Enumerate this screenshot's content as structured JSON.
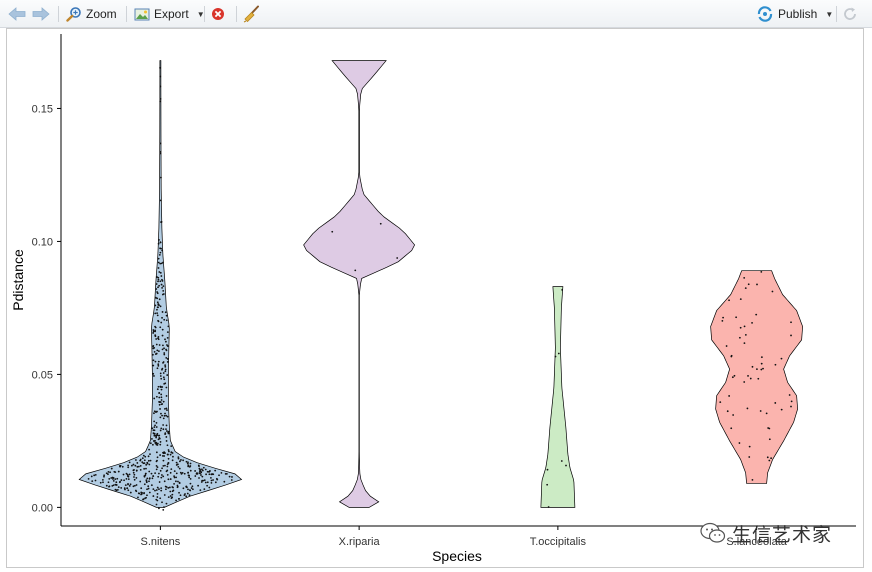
{
  "toolbar": {
    "zoom_label": "Zoom",
    "export_label": "Export",
    "publish_label": "Publish"
  },
  "chart_data": {
    "type": "violin",
    "xlabel": "Species",
    "ylabel": "Pdistance",
    "categories": [
      "S.nitens",
      "X.riparia",
      "T.occipitalis",
      "S.lanceolata"
    ],
    "ylim": [
      -0.007,
      0.178
    ],
    "yticks": [
      0.0,
      0.05,
      0.1,
      0.15
    ],
    "ytick_labels": [
      "0.00",
      "0.05",
      "0.10",
      "0.15"
    ],
    "grid": false,
    "legend": "none",
    "series": [
      {
        "fill": "#b3cde3",
        "points_n": 600,
        "profile": [
          [
            0.0,
            4
          ],
          [
            0.004,
            28
          ],
          [
            0.008,
            62
          ],
          [
            0.011,
            85
          ],
          [
            0.013,
            72
          ],
          [
            0.016,
            42
          ],
          [
            0.02,
            16
          ],
          [
            0.025,
            10
          ],
          [
            0.03,
            9
          ],
          [
            0.04,
            8
          ],
          [
            0.05,
            8
          ],
          [
            0.06,
            8.5
          ],
          [
            0.068,
            9
          ],
          [
            0.075,
            6
          ],
          [
            0.085,
            4.5
          ],
          [
            0.095,
            2.5
          ],
          [
            0.105,
            1.5
          ],
          [
            0.12,
            0.8
          ],
          [
            0.14,
            0.6
          ],
          [
            0.16,
            0.5
          ],
          [
            0.168,
            0.5
          ]
        ]
      },
      {
        "fill": "#decbe4",
        "points_n": 4,
        "profile": [
          [
            0.0,
            10
          ],
          [
            0.002,
            20
          ],
          [
            0.005,
            8
          ],
          [
            0.01,
            2
          ],
          [
            0.013,
            0.6
          ],
          [
            0.02,
            0.2
          ],
          [
            0.08,
            0.2
          ],
          [
            0.086,
            2
          ],
          [
            0.092,
            38
          ],
          [
            0.098,
            57
          ],
          [
            0.104,
            44
          ],
          [
            0.11,
            22
          ],
          [
            0.118,
            4
          ],
          [
            0.125,
            0.3
          ],
          [
            0.15,
            0.3
          ],
          [
            0.157,
            2
          ],
          [
            0.163,
            16
          ],
          [
            0.168,
            27
          ]
        ]
      },
      {
        "fill": "#ccebc5",
        "points_n": 8,
        "profile": [
          [
            0.0,
            17
          ],
          [
            0.01,
            16
          ],
          [
            0.015,
            12
          ],
          [
            0.02,
            10
          ],
          [
            0.03,
            8
          ],
          [
            0.045,
            4
          ],
          [
            0.06,
            2.5
          ],
          [
            0.075,
            3.5
          ],
          [
            0.083,
            5
          ]
        ]
      },
      {
        "fill": "#fbb4ae",
        "points_n": 60,
        "profile": [
          [
            0.009,
            10
          ],
          [
            0.013,
            11
          ],
          [
            0.018,
            16
          ],
          [
            0.025,
            27
          ],
          [
            0.032,
            37
          ],
          [
            0.037,
            41
          ],
          [
            0.042,
            40
          ],
          [
            0.047,
            31
          ],
          [
            0.052,
            27
          ],
          [
            0.057,
            33
          ],
          [
            0.063,
            45
          ],
          [
            0.068,
            46
          ],
          [
            0.074,
            40
          ],
          [
            0.08,
            26
          ],
          [
            0.086,
            18
          ],
          [
            0.089,
            15
          ]
        ]
      }
    ]
  },
  "watermark": {
    "text": "生信艺术家"
  }
}
